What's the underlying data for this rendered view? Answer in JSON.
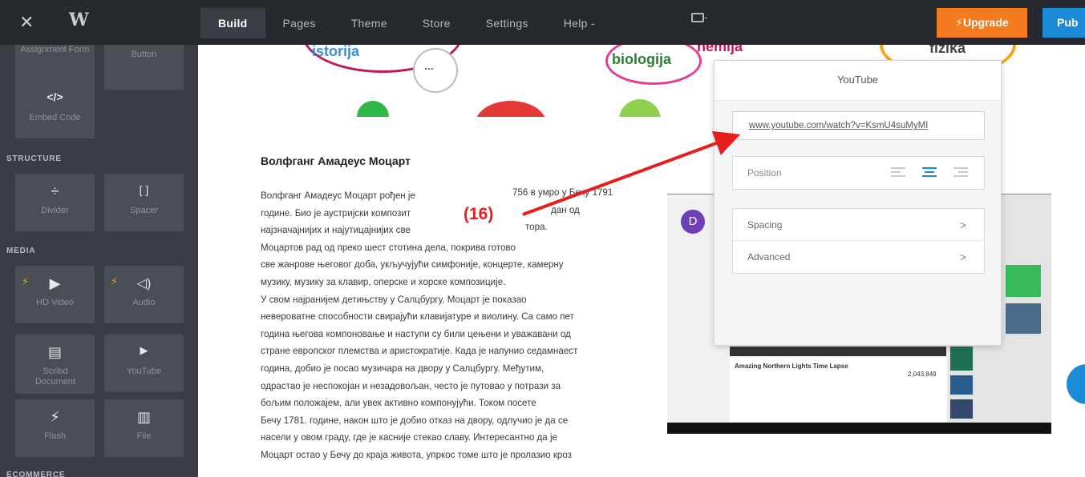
{
  "topbar": {
    "close_glyph": "✕",
    "logo_glyph": "W",
    "nav": [
      "Build",
      "Pages",
      "Theme",
      "Store",
      "Settings",
      "Help"
    ],
    "help_caret": "-",
    "monitor_caret": "-",
    "upgrade_label": "Upgrade",
    "upgrade_bolt": "⚡",
    "publish_label": "Pub"
  },
  "sidebar": {
    "tiles_top": [
      "Assignment Form",
      "Button"
    ],
    "embed": {
      "icon": "</>",
      "label": "Embed Code"
    },
    "structure_title": "STRUCTURE",
    "structure": [
      {
        "icon": "÷",
        "label": "Divider"
      },
      {
        "icon": "[ ]",
        "label": "Spacer"
      }
    ],
    "media_title": "MEDIA",
    "media": [
      {
        "icon": "▶",
        "label": "HD Video"
      },
      {
        "icon": "◁)",
        "label": "Audio"
      },
      {
        "icon": "▤",
        "label": "Scribd Document"
      },
      {
        "icon": "▶",
        "label": "YouTube"
      },
      {
        "icon": "⚡",
        "label": "Flash"
      },
      {
        "icon": "▥",
        "label": "File"
      }
    ],
    "ecommerce_title": "ECOMMERCE"
  },
  "banner": {
    "words": [
      "istorija",
      "...",
      "biologija",
      "hemija",
      "fizika"
    ]
  },
  "content": {
    "heading": "Волфганг Амадеус Моцарт",
    "lines": [
      "Волфганг Амадеус Моцарт рођен је",
      "године. Био је аустријски композит",
      "најзначајнијих и најутицајнијих све",
      "Моцартов рад од преко шест стотина дела, покрива готово",
      "све жанрове његовог доба, укључујући симфоније, концерте, камерну",
      "музику, музику за клавир, оперске и хорске композиције.",
      "У свом најранијем детињству у Салцбургу, Моцарт је показао",
      "невероватне способности свирајући клавијатуре и виолину. Са само пет",
      "година његова компоновање и наступи су били цењени и уважавани од",
      "стране европског племства и аристократије. Када је напунио седамнаест",
      "година, добио је посао музичара на двору у Салцбургу. Међутим,",
      "одрастао је неспокојан и незадовољан, често је путовао у потрази за",
      "бољим положајем, али увек активно компонујући. Током посете",
      "Бечу 1781. године, након што је добио отказ на двору, одлучио је да се",
      "насели у овом граду, где је касније стекао славу. Интересантно да је",
      "Моцарт остао у Бечу до краја живота, упркос томе што је пролазио кроз"
    ],
    "line1_tail": "756 в умро у Бечу 1791",
    "line2_tail": "дан од",
    "line3_tail": "тора."
  },
  "video": {
    "avatar_letter": "D",
    "video_title": "Amazing Northern Lights Time Lapse",
    "views": "2,043,849"
  },
  "youtube_panel": {
    "title": "YouTube",
    "url": "www.youtube.com/watch?v=KsmU4suMyMI",
    "position_label": "Position",
    "spacing_label": "Spacing",
    "advanced_label": "Advanced",
    "chevron": ">"
  },
  "annotation": {
    "label": "(16)",
    "color": "#e61e1e"
  }
}
